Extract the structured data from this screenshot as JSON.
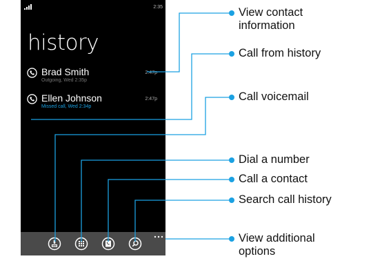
{
  "status_bar": {
    "time": "2:35"
  },
  "page": {
    "title": "history"
  },
  "entries": [
    {
      "name": "Brad Smith",
      "detail": "Outgoing, Wed 2:35p",
      "time": "2:47p"
    },
    {
      "name": "Ellen Johnson",
      "detail": "Missed call, Wed 2:34p",
      "time": "2:47p"
    }
  ],
  "app_bar": {
    "buttons": [
      "voicemail-icon",
      "keypad-icon",
      "contacts-icon",
      "search-icon"
    ],
    "more": "..."
  },
  "callouts": {
    "view_contact": {
      "line1": "View contact",
      "line2": "information"
    },
    "call_from_history": "Call from history",
    "call_voicemail": "Call voicemail",
    "dial_number": "Dial a number",
    "call_contact": "Call a contact",
    "search_history": "Search call history",
    "view_options": {
      "line1": "View additional",
      "line2": "options"
    }
  },
  "colors": {
    "accent": "#1ba1e2",
    "phone_bg": "#000000",
    "appbar_bg": "#4a4a4a",
    "callout_text": "#111111"
  }
}
